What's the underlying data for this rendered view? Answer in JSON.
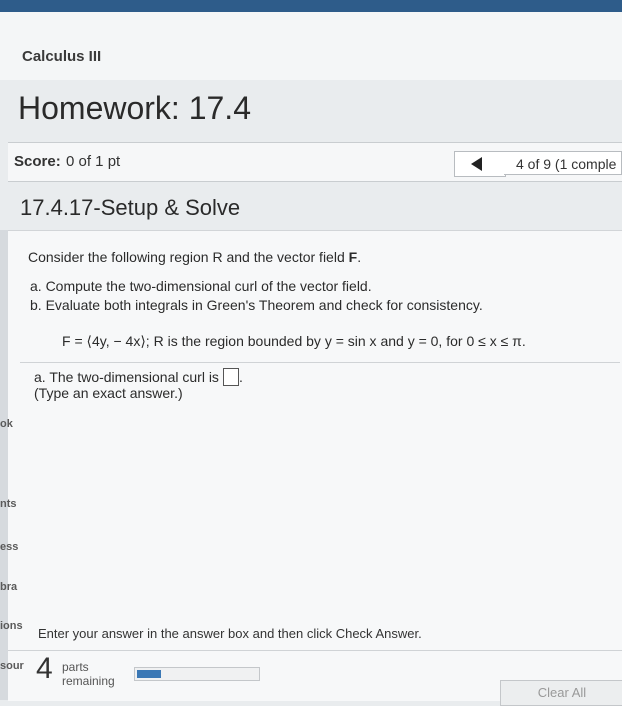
{
  "course": {
    "title": "Calculus III"
  },
  "homework": {
    "title": "Homework: 17.4"
  },
  "score": {
    "label": "Score:",
    "value": "0 of 1 pt"
  },
  "navigation": {
    "position": "4 of 9 (1 comple"
  },
  "question": {
    "title": "17.4.17-Setup & Solve",
    "intro_text": "Consider the following region R and the vector field ",
    "intro_bold": "F",
    "intro_end": ".",
    "part_a": "a. Compute the two-dimensional curl of the vector field.",
    "part_b": "b. Evaluate both integrals in Green's Theorem and check for consistency.",
    "formula": "F = ⟨4y, − 4x⟩; R is the region bounded by y = sin x and y = 0, for 0 ≤ x ≤ π.",
    "answer_prompt": "a. The two-dimensional curl is",
    "answer_suffix": ".",
    "answer_hint": "(Type an exact answer.)"
  },
  "side_labels": {
    "ok": "ok",
    "nts": "nts",
    "ess": "ess",
    "bra": "bra",
    "ions": "ions",
    "sour": "sour"
  },
  "footer": {
    "instructions": "Enter your answer in the answer box and then click Check Answer.",
    "parts_count": "4",
    "parts_word": "parts",
    "parts_remaining": "remaining",
    "progress_fraction": 0.2,
    "clear_label": "Clear All"
  }
}
